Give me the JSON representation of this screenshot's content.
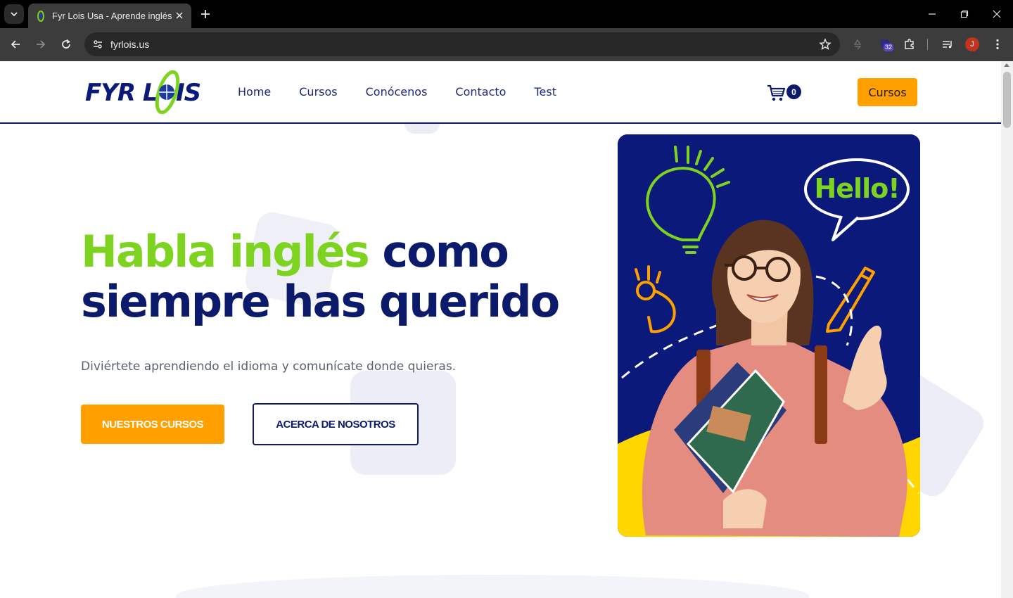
{
  "browser": {
    "tab_title": "Fyr Lois Usa - Aprende inglés",
    "url": "fyrlois.us",
    "extension_badge": "32",
    "profile_initial": "J"
  },
  "header": {
    "logo_text": "FYR LOIS",
    "nav": [
      "Home",
      "Cursos",
      "Conócenos",
      "Contacto",
      "Test"
    ],
    "cart_count": "0",
    "cta_label": "Cursos"
  },
  "hero": {
    "title_green": "Habla inglés",
    "title_rest_1": "como",
    "title_rest_2": "siempre has querido",
    "subtitle": "Diviértete aprendiendo el idioma y comunícate donde quieras.",
    "primary_button": "NUESTROS CURSOS",
    "secondary_button": "ACERCA DE NOSOTROS",
    "speech_bubble": "Hello!"
  },
  "colors": {
    "brand_navy": "#0b1a6b",
    "brand_green": "#7ed321",
    "brand_orange": "#ffa000",
    "card_yellow": "#ffd600"
  },
  "icons": [
    "tab-list-icon",
    "favicon-icon",
    "close-icon",
    "plus-icon",
    "minimize-icon",
    "restore-icon",
    "back-icon",
    "forward-icon",
    "reload-icon",
    "site-info-icon",
    "star-icon",
    "recycle-icon",
    "puzzle-icon",
    "media-icon",
    "more-icon",
    "cart-icon"
  ]
}
